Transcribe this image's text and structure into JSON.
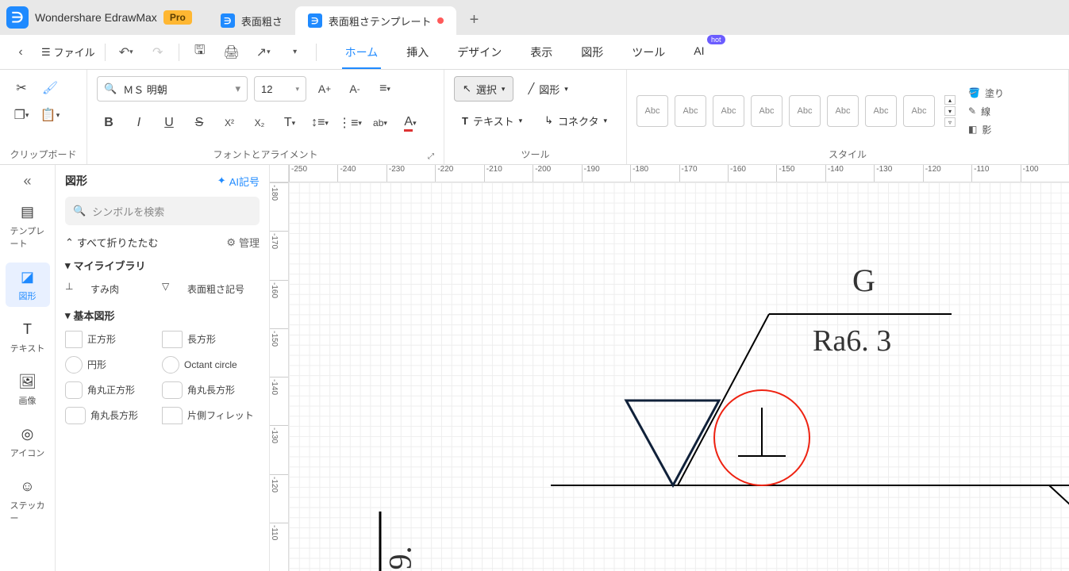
{
  "app": {
    "name": "Wondershare EdrawMax",
    "badge": "Pro"
  },
  "tabs": [
    {
      "label": "表面粗さ",
      "active": false,
      "dirty": false
    },
    {
      "label": "表面粗さテンプレート",
      "active": true,
      "dirty": true
    }
  ],
  "file_menu": "ファイル",
  "menu": {
    "home": "ホーム",
    "insert": "挿入",
    "design": "デザイン",
    "view": "表示",
    "shapes": "図形",
    "tools": "ツール",
    "ai": "AI",
    "hot": "hot"
  },
  "ribbon": {
    "clipboard_label": "クリップボード",
    "font_label": "フォントとアライメント",
    "tool_label": "ツール",
    "style_label": "スタイル",
    "font_name": "ＭＳ 明朝",
    "font_size": "12",
    "select": "選択",
    "shape": "図形",
    "text": "テキスト",
    "connector": "コネクタ",
    "abc": "Abc",
    "fill": "塗り",
    "line": "線",
    "shadow": "影"
  },
  "leftnav": {
    "templates": "テンプレート",
    "shapes": "図形",
    "text": "テキスト",
    "images": "画像",
    "icons": "アイコン",
    "stickers": "ステッカー"
  },
  "panel": {
    "title": "図形",
    "ai_symbol": "AI記号",
    "search_placeholder": "シンボルを検索",
    "collapse_all": "すべて折りたたむ",
    "manage": "管理",
    "my_library": "マイライブラリ",
    "sumi": "すみ肉",
    "surface": "表面粗さ記号",
    "basic_shapes": "基本図形",
    "square": "正方形",
    "rectangle": "長方形",
    "circle": "円形",
    "octant": "Octant circle",
    "round_square": "角丸正方形",
    "round_rect": "角丸長方形",
    "round_rect2": "角丸長方形",
    "fillet": "片側フィレット"
  },
  "ruler_h": [
    "-250",
    "-240",
    "-230",
    "-220",
    "-210",
    "-200",
    "-190",
    "-180",
    "-170",
    "-160",
    "-150",
    "-140",
    "-130",
    "-120",
    "-110",
    "-100"
  ],
  "ruler_v": [
    "-180",
    "-170",
    "-160",
    "-150",
    "-140",
    "-130",
    "-120",
    "-110"
  ],
  "canvas": {
    "G": "G",
    "Ra": "Ra6. 3",
    "nine": "9."
  }
}
